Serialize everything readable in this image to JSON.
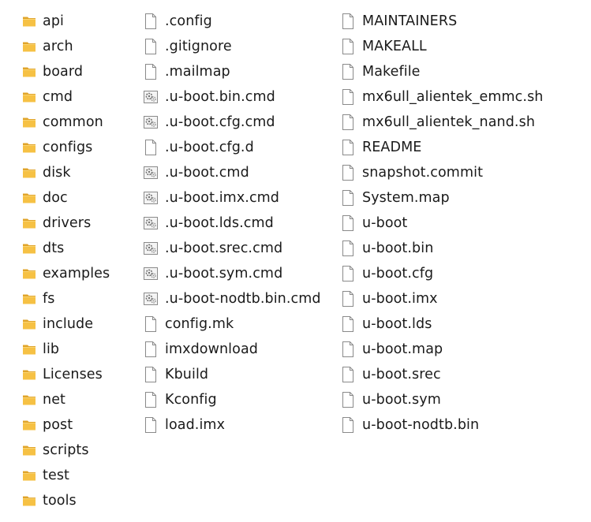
{
  "folders": [
    "api",
    "arch",
    "board",
    "cmd",
    "common",
    "configs",
    "disk",
    "doc",
    "drivers",
    "dts",
    "examples",
    "fs",
    "include",
    "lib",
    "Licenses",
    "net",
    "post",
    "scripts",
    "test",
    "tools"
  ],
  "files_column_1": [
    {
      "name": ".config",
      "icon": "blank-file-icon"
    },
    {
      "name": ".gitignore",
      "icon": "blank-file-icon"
    },
    {
      "name": ".mailmap",
      "icon": "blank-file-icon"
    },
    {
      "name": ".u-boot.bin.cmd",
      "icon": "script-file-icon"
    },
    {
      "name": ".u-boot.cfg.cmd",
      "icon": "script-file-icon"
    },
    {
      "name": ".u-boot.cfg.d",
      "icon": "blank-file-icon"
    },
    {
      "name": ".u-boot.cmd",
      "icon": "script-file-icon"
    },
    {
      "name": ".u-boot.imx.cmd",
      "icon": "script-file-icon"
    },
    {
      "name": ".u-boot.lds.cmd",
      "icon": "script-file-icon"
    },
    {
      "name": ".u-boot.srec.cmd",
      "icon": "script-file-icon"
    },
    {
      "name": ".u-boot.sym.cmd",
      "icon": "script-file-icon"
    },
    {
      "name": ".u-boot-nodtb.bin.cmd",
      "icon": "script-file-icon"
    },
    {
      "name": "config.mk",
      "icon": "blank-file-icon"
    },
    {
      "name": "imxdownload",
      "icon": "blank-file-icon"
    },
    {
      "name": "Kbuild",
      "icon": "blank-file-icon"
    },
    {
      "name": "Kconfig",
      "icon": "blank-file-icon"
    },
    {
      "name": "load.imx",
      "icon": "blank-file-icon"
    }
  ],
  "files_column_2": [
    {
      "name": "MAINTAINERS",
      "icon": "blank-file-icon"
    },
    {
      "name": "MAKEALL",
      "icon": "blank-file-icon"
    },
    {
      "name": "Makefile",
      "icon": "blank-file-icon"
    },
    {
      "name": "mx6ull_alientek_emmc.sh",
      "icon": "blank-file-icon"
    },
    {
      "name": "mx6ull_alientek_nand.sh",
      "icon": "blank-file-icon"
    },
    {
      "name": "README",
      "icon": "blank-file-icon"
    },
    {
      "name": "snapshot.commit",
      "icon": "blank-file-icon"
    },
    {
      "name": "System.map",
      "icon": "blank-file-icon"
    },
    {
      "name": "u-boot",
      "icon": "blank-file-icon"
    },
    {
      "name": "u-boot.bin",
      "icon": "blank-file-icon"
    },
    {
      "name": "u-boot.cfg",
      "icon": "blank-file-icon"
    },
    {
      "name": "u-boot.imx",
      "icon": "blank-file-icon"
    },
    {
      "name": "u-boot.lds",
      "icon": "blank-file-icon"
    },
    {
      "name": "u-boot.map",
      "icon": "blank-file-icon"
    },
    {
      "name": "u-boot.srec",
      "icon": "blank-file-icon"
    },
    {
      "name": "u-boot.sym",
      "icon": "blank-file-icon"
    },
    {
      "name": "u-boot-nodtb.bin",
      "icon": "blank-file-icon"
    }
  ],
  "colors": {
    "folder_body": "#F6C144",
    "folder_back": "#E0A42A",
    "file_outline": "#8a8a8a",
    "text": "#1a1a1a"
  }
}
